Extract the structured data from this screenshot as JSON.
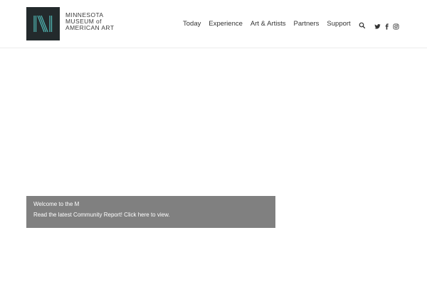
{
  "logo": {
    "lines": [
      "MINNESOTA",
      "MUSEUM of",
      "AMERICAN ART"
    ],
    "mark_icon": "museum-m-logo",
    "mark_bg": "#232a2c",
    "mark_stroke": "#4fb3b0"
  },
  "nav": {
    "items": [
      {
        "label": "Today"
      },
      {
        "label": "Experience"
      },
      {
        "label": "Art & Artists"
      },
      {
        "label": "Partners"
      },
      {
        "label": "Support"
      }
    ],
    "search_icon": "search-icon"
  },
  "social": {
    "icons": [
      "twitter-icon",
      "facebook-icon",
      "instagram-icon"
    ]
  },
  "banner": {
    "title": "Welcome to the M",
    "message": "Read the latest Community Report! Click here to view.",
    "bg_color": "#808080"
  }
}
